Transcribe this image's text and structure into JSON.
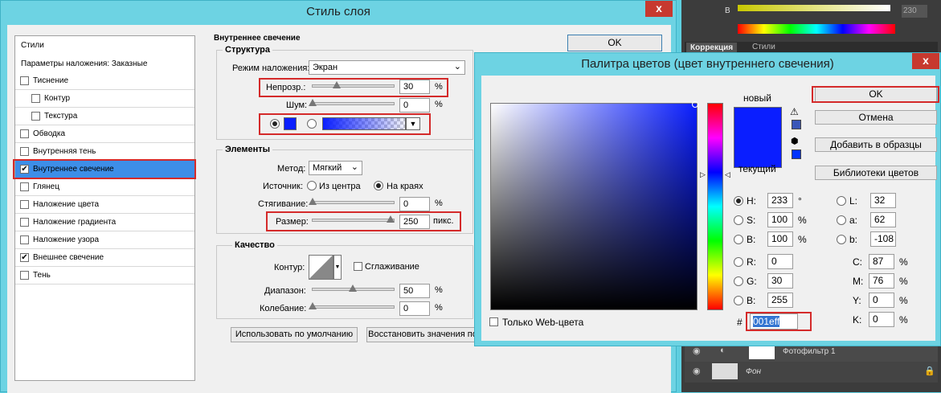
{
  "layer_style": {
    "title": "Стиль слоя",
    "close": "x",
    "ok": "OK",
    "styles_header": "Стили",
    "blending_options": "Параметры наложения: Заказные",
    "items": [
      {
        "label": "Тиснение",
        "checked": false,
        "indent": false
      },
      {
        "label": "Контур",
        "checked": false,
        "indent": true
      },
      {
        "label": "Текстура",
        "checked": false,
        "indent": true
      },
      {
        "label": "Обводка",
        "checked": false,
        "indent": false
      },
      {
        "label": "Внутренняя тень",
        "checked": false,
        "indent": false
      },
      {
        "label": "Внутреннее свечение",
        "checked": true,
        "indent": false,
        "selected": true
      },
      {
        "label": "Глянец",
        "checked": false,
        "indent": false
      },
      {
        "label": "Наложение цвета",
        "checked": false,
        "indent": false
      },
      {
        "label": "Наложение градиента",
        "checked": false,
        "indent": false
      },
      {
        "label": "Наложение узора",
        "checked": false,
        "indent": false
      },
      {
        "label": "Внешнее свечение",
        "checked": true,
        "indent": false
      },
      {
        "label": "Тень",
        "checked": false,
        "indent": false
      }
    ],
    "section_title": "Внутреннее свечение",
    "structure": {
      "title": "Структура",
      "blend_mode_label": "Режим наложения:",
      "blend_mode_value": "Экран",
      "opacity_label": "Непрозр.:",
      "opacity_value": "30",
      "noise_label": "Шум:",
      "noise_value": "0",
      "percent": "%",
      "glow_color": "#0a1eff"
    },
    "elements": {
      "title": "Элементы",
      "method_label": "Метод:",
      "method_value": "Мягкий",
      "source_label": "Источник:",
      "source_center": "Из центра",
      "source_edge": "На краях",
      "choke_label": "Стягивание:",
      "choke_value": "0",
      "size_label": "Размер:",
      "size_value": "250",
      "size_unit": "пикс.",
      "percent": "%"
    },
    "quality": {
      "title": "Качество",
      "contour_label": "Контур:",
      "antialias_label": "Сглаживание",
      "range_label": "Диапазон:",
      "range_value": "50",
      "jitter_label": "Колебание:",
      "jitter_value": "0",
      "percent": "%"
    },
    "default_btn": "Использовать по умолчанию",
    "reset_btn": "Восстановить значения по"
  },
  "color_picker": {
    "title": "Палитра цветов (цвет внутреннего свечения)",
    "close": "x",
    "ok": "OK",
    "cancel": "Отмена",
    "add_swatches": "Добавить в образцы",
    "color_libraries": "Библиотеки цветов",
    "new_label": "новый",
    "current_label": "текущий",
    "new_color": "#0a1eff",
    "current_color": "#0a1eff",
    "web_only": "Только Web-цвета",
    "hash": "#",
    "hex_value": "001eff",
    "fields": {
      "H": {
        "label": "H:",
        "value": "233",
        "unit": "°"
      },
      "S": {
        "label": "S:",
        "value": "100",
        "unit": "%"
      },
      "B": {
        "label": "B:",
        "value": "100",
        "unit": "%"
      },
      "R": {
        "label": "R:",
        "value": "0"
      },
      "G": {
        "label": "G:",
        "value": "30"
      },
      "B2": {
        "label": "B:",
        "value": "255"
      },
      "L": {
        "label": "L:",
        "value": "32"
      },
      "a": {
        "label": "a:",
        "value": "62"
      },
      "b": {
        "label": "b:",
        "value": "-108"
      },
      "C": {
        "label": "C:",
        "value": "87",
        "unit": "%"
      },
      "M": {
        "label": "M:",
        "value": "76",
        "unit": "%"
      },
      "Y": {
        "label": "Y:",
        "value": "0",
        "unit": "%"
      },
      "K": {
        "label": "K:",
        "value": "0",
        "unit": "%"
      }
    }
  },
  "bg_panel": {
    "b_label": "B",
    "b_value": "230",
    "tab_correction": "Коррекция",
    "tab_styles": "Стили",
    "layer_photofilter": "Фотофильтр 1",
    "layer_background": "Фон"
  }
}
